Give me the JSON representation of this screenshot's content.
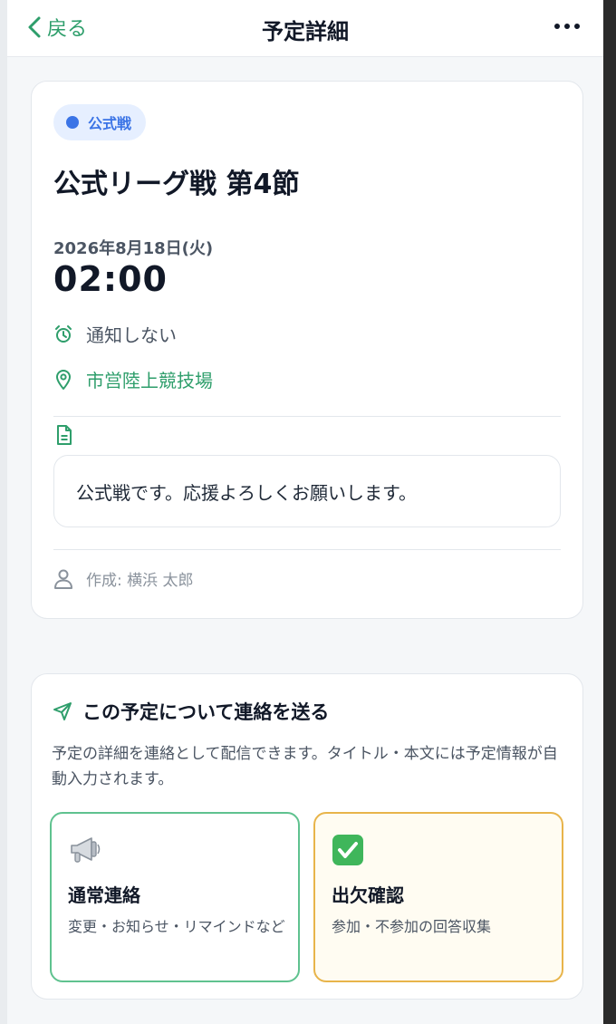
{
  "header": {
    "back_label": "戻る",
    "title": "予定詳細"
  },
  "event": {
    "badge": "公式戦",
    "title": "公式リーグ戦 第4節",
    "date": "2026年8月18日(火)",
    "time": "02:00",
    "notification": "通知しない",
    "location": "市営陸上競技場",
    "memo": "公式戦です。応援よろしくお願いします。",
    "author": "作成: 横浜 太郎"
  },
  "send": {
    "title": "この予定について連絡を送る",
    "description": "予定の詳細を連絡として配信できます。タイトル・本文には予定情報が自動入力されます。",
    "options": [
      {
        "label": "通常連絡",
        "description": "変更・お知らせ・リマインドなど",
        "icon": "megaphone-icon"
      },
      {
        "label": "出欠確認",
        "description": "参加・不参加の回答収集",
        "icon": "check-mark-icon"
      }
    ]
  },
  "colors": {
    "accent_green": "#2e9e6b",
    "badge_blue": "#3b74e6",
    "attend_border": "#e8b44a"
  }
}
